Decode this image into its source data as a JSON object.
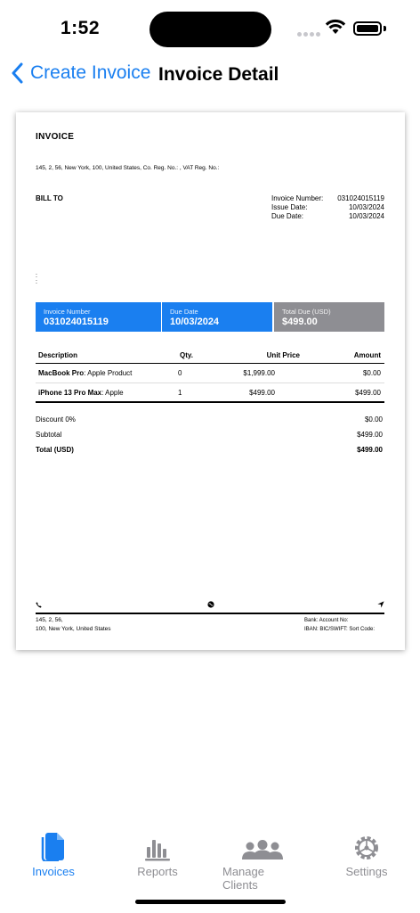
{
  "status": {
    "time": "1:52"
  },
  "nav": {
    "back_label": "Create Invoice",
    "title": "Invoice Detail"
  },
  "invoice": {
    "title": "INVOICE",
    "address_line": "145, 2, 56, New York, 100, United States,  Co. Reg. No.: , VAT Reg. No.:",
    "bill_to": "BILL TO",
    "meta": [
      {
        "label": "Invoice Number:",
        "value": "031024015119"
      },
      {
        "label": "Issue Date:",
        "value": "10/03/2024"
      },
      {
        "label": "Due Date:",
        "value": "10/03/2024"
      }
    ],
    "colons": [
      ":",
      ":"
    ],
    "summary": {
      "invoice_number_label": "Invoice Number",
      "invoice_number": "031024015119",
      "due_date_label": "Due Date",
      "due_date": "10/03/2024",
      "total_due_label": "Total Due (USD)",
      "total_due": "$499.00"
    },
    "columns": {
      "description": "Description",
      "qty": "Qty.",
      "unit_price": "Unit Price",
      "amount": "Amount"
    },
    "items": [
      {
        "name": "MacBook Pro",
        "sub": ": Apple Product",
        "qty": "0",
        "unit_price": "$1,999.00",
        "amount": "$0.00"
      },
      {
        "name": "iPhone 13 Pro Max",
        "sub": ": Apple",
        "qty": "1",
        "unit_price": "$499.00",
        "amount": "$499.00"
      }
    ],
    "totals": [
      {
        "label": "Discount 0%",
        "value": "$0.00"
      },
      {
        "label": "Subtotal",
        "value": "$499.00"
      },
      {
        "label": "Total (USD)",
        "value": "$499.00"
      }
    ],
    "footer": {
      "address_1": "145, 2, 56,",
      "address_2": "100, New York, United States",
      "bank_line": "Bank:   Account No:",
      "iban_line": "IBAN:  BIC/SWIFT:   Sort Code:"
    }
  },
  "tabs": [
    {
      "label": "Invoices",
      "icon": "document-icon",
      "active": true
    },
    {
      "label": "Reports",
      "icon": "chart-icon",
      "active": false
    },
    {
      "label": "Manage Clients",
      "icon": "people-icon",
      "active": false
    },
    {
      "label": "Settings",
      "icon": "gear-icon",
      "active": false
    }
  ],
  "colors": {
    "accent": "#1a7ff0",
    "gray_box": "#8e8e93",
    "tab_inactive": "#8e8e93"
  }
}
